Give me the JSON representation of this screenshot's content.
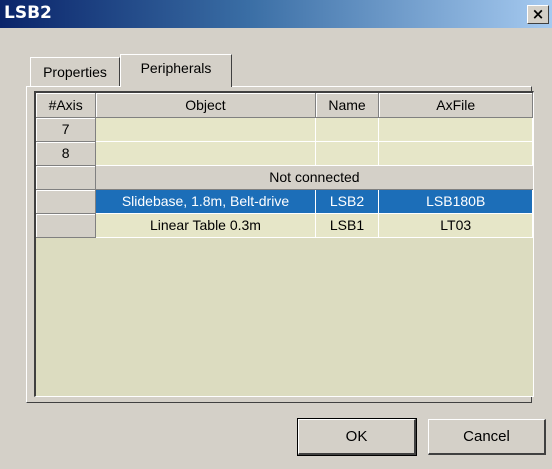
{
  "window": {
    "title": "LSB2",
    "close_label": "×"
  },
  "tabs": [
    {
      "label": "Properties"
    },
    {
      "label": "Peripherals"
    }
  ],
  "table": {
    "columns": [
      "#Axis",
      "Object",
      "Name",
      "AxFile"
    ],
    "rows": [
      {
        "axis": "7",
        "object": "",
        "name": "",
        "axfile": ""
      },
      {
        "axis": "8",
        "object": "",
        "name": "",
        "axfile": ""
      }
    ],
    "group_label": "Not connected",
    "peripherals": [
      {
        "axis": "",
        "object": "Slidebase, 1.8m, Belt-drive",
        "name": "LSB2",
        "axfile": "LSB180B",
        "selected": true
      },
      {
        "axis": "",
        "object": "Linear Table 0.3m",
        "name": "LSB1",
        "axfile": "LT03",
        "selected": false
      }
    ]
  },
  "buttons": {
    "ok_label": "OK",
    "cancel_label": "Cancel"
  },
  "colors": {
    "selection": "#1c6eb8",
    "grid_background": "#dcdcc0",
    "title_gradient_start": "#0a246a"
  }
}
